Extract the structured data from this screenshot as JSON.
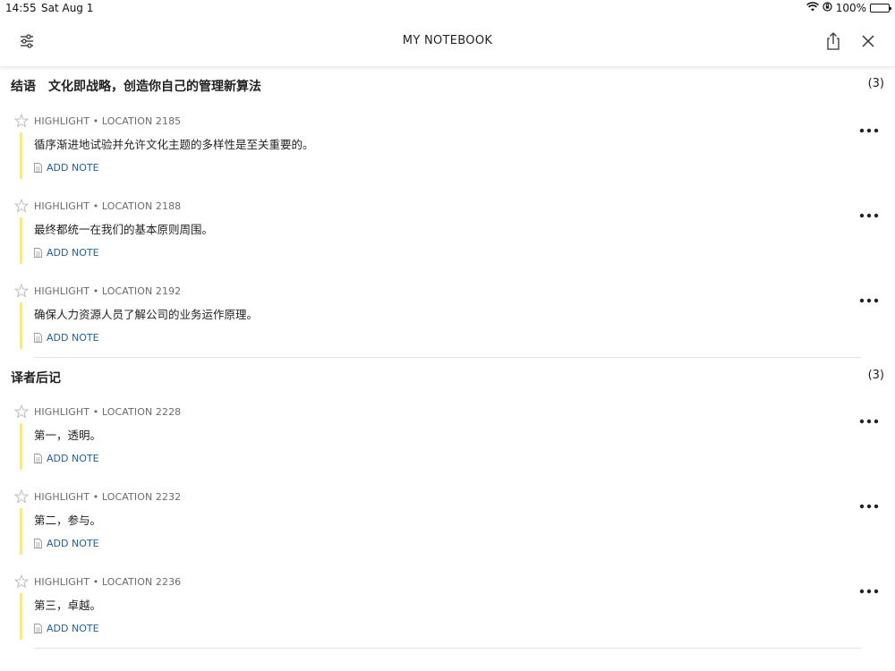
{
  "status": {
    "time": "14:55",
    "date": "Sat Aug 1",
    "battery": "100%"
  },
  "nav": {
    "title": "MY NOTEBOOK",
    "left_icon": "sliders-icon",
    "share_icon": "share-icon",
    "close_icon": "close-icon"
  },
  "colors": {
    "highlight_bar": "#f7e98e",
    "note_link": "#1f5f9f"
  },
  "sections": [
    {
      "title": "结语　文化即战略，创造你自己的管理新算法",
      "count": "(3)",
      "entries": [
        {
          "meta": "HIGHLIGHT • LOCATION 2185",
          "text": "循序渐进地试验并允许文化主题的多样性是至关重要的。",
          "note": "ADD NOTE"
        },
        {
          "meta": "HIGHLIGHT • LOCATION 2188",
          "text": "最终都统一在我们的基本原则周围。",
          "note": "ADD NOTE"
        },
        {
          "meta": "HIGHLIGHT • LOCATION 2192",
          "text": "确保人力资源人员了解公司的业务运作原理。",
          "note": "ADD NOTE"
        }
      ]
    },
    {
      "title": "译者后记",
      "count": "(3)",
      "entries": [
        {
          "meta": "HIGHLIGHT • LOCATION 2228",
          "text": "第一，透明。",
          "note": "ADD NOTE"
        },
        {
          "meta": "HIGHLIGHT • LOCATION 2232",
          "text": "第二，参与。",
          "note": "ADD NOTE"
        },
        {
          "meta": "HIGHLIGHT • LOCATION 2236",
          "text": "第三，卓越。",
          "note": "ADD NOTE"
        }
      ]
    }
  ]
}
